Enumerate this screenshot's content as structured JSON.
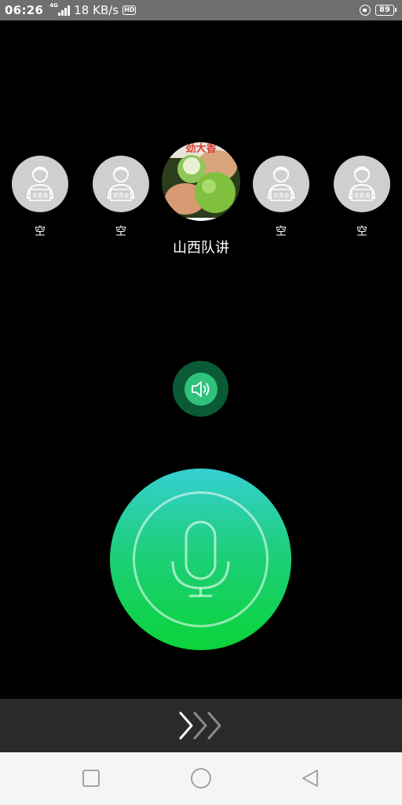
{
  "status_bar": {
    "time": "06:26",
    "network_type": "4G",
    "speed": "18 KB/s",
    "hd": "HD",
    "battery": "89"
  },
  "seats": [
    {
      "label": "空",
      "avatar_text": "求真香"
    },
    {
      "label": "空",
      "avatar_text": "求真香"
    },
    {
      "label": "山西队讲",
      "avatar_image_text": "劲大香"
    },
    {
      "label": "空",
      "avatar_text": "求真香"
    },
    {
      "label": "空",
      "avatar_text": "求真香"
    }
  ],
  "controls": {
    "speaker_icon": "speaker-icon",
    "mic_icon": "microphone-icon",
    "swipe_icon": "chevrons-right-icon"
  },
  "nav": {
    "recent": "square-icon",
    "home": "circle-icon",
    "back": "triangle-left-icon"
  },
  "colors": {
    "background": "#000000",
    "status_bar": "#6f6f6f",
    "speaker_outer": "#0b5a36",
    "speaker_inner": "#2fc27d",
    "mic_top": "#36cfd3",
    "mic_bottom": "#0bd33a",
    "swipe_bar": "#2a2a2a",
    "nav_bar": "#f5f5f5"
  }
}
